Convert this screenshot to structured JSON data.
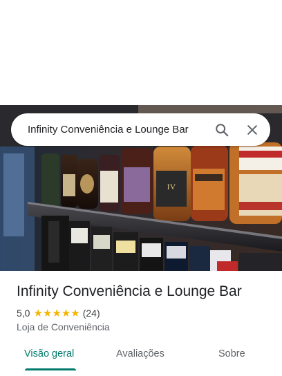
{
  "search": {
    "query": "Infinity Conveniência e Lounge Bar"
  },
  "place": {
    "name": "Infinity Conveniência e Lounge Bar",
    "rating": "5,0",
    "stars": 5,
    "review_count": "(24)",
    "category": "Loja de Conveniência"
  },
  "tabs": [
    {
      "label": "Visão geral",
      "active": true
    },
    {
      "label": "Avaliações",
      "active": false
    },
    {
      "label": "Sobre",
      "active": false
    }
  ],
  "colors": {
    "accent": "#00796b",
    "star": "#f4b400",
    "text": "#202124",
    "secondary": "#5f6368"
  },
  "icons": [
    "search-icon",
    "close-icon",
    "star-icon"
  ]
}
